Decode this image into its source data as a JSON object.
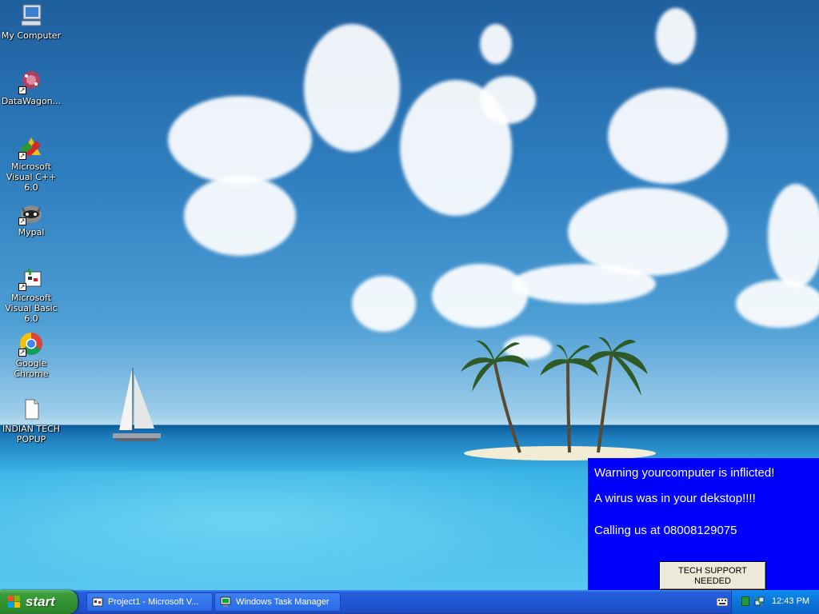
{
  "desktop": {
    "icons": [
      {
        "label": "My Computer",
        "icon": "my-computer-icon"
      },
      {
        "label": "DataWagon...",
        "icon": "datawagon-icon"
      },
      {
        "label": "Microsoft Visual C++ 6.0",
        "icon": "visual-cpp-icon"
      },
      {
        "label": "Mypal",
        "icon": "mypal-icon"
      },
      {
        "label": "Microsoft Visual Basic 6.0",
        "icon": "visual-basic-icon"
      },
      {
        "label": "Google Chrome",
        "icon": "chrome-icon"
      },
      {
        "label": "INDIAN TECH POPUP",
        "icon": "document-icon"
      }
    ]
  },
  "popup": {
    "line1": "Warning yourcomputer is inflicted!",
    "line2": "A wirus was in your dekstop!!!!",
    "line3": "Calling us at 08008129075",
    "button_label": "TECH SUPPORT NEEDED",
    "background_color": "#0000ff"
  },
  "taskbar": {
    "start_label": "start",
    "tasks": [
      {
        "label": "Project1 - Microsoft V...",
        "icon": "vb-project-icon"
      },
      {
        "label": "Windows Task Manager",
        "icon": "task-manager-icon"
      }
    ],
    "clock": "12:43 PM"
  }
}
